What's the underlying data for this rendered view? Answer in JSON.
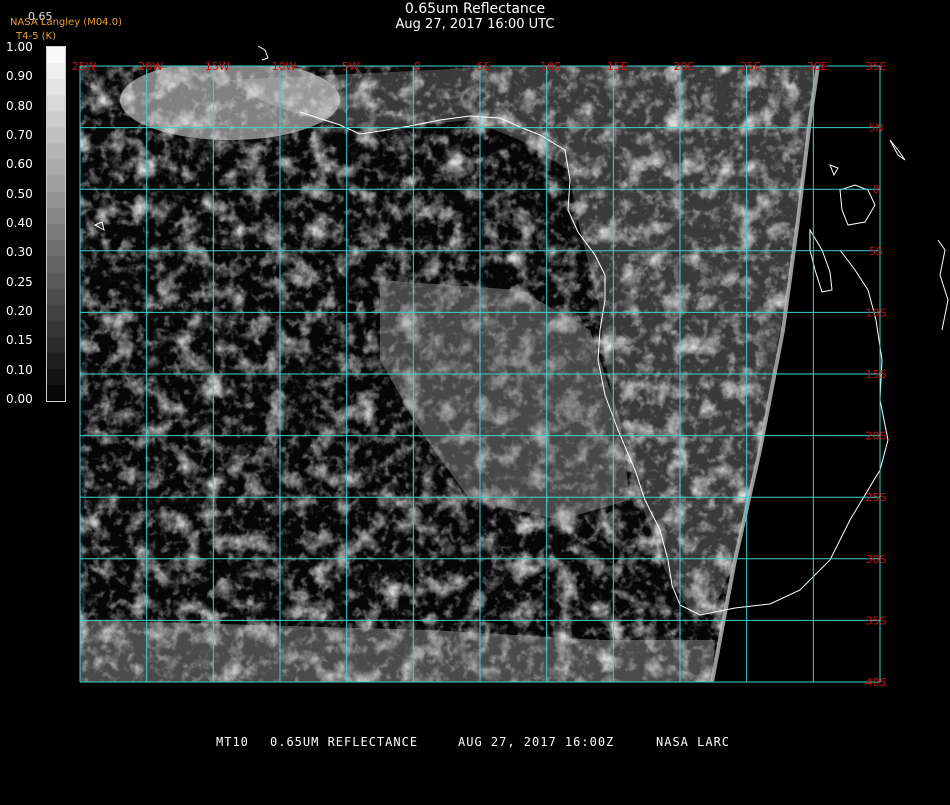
{
  "header": {
    "title": "0.65um Reflectance",
    "subtitle": "Aug 27, 2017 16:00 UTC",
    "source": "NASA Langley (M04.0)",
    "channel": "T4-5 (K)",
    "top_value": "0.65"
  },
  "colorbar": {
    "ticks": [
      "1.00",
      "0.90",
      "0.80",
      "0.70",
      "0.60",
      "0.50",
      "0.40",
      "0.30",
      "0.25",
      "0.20",
      "0.15",
      "0.10",
      "0.00"
    ]
  },
  "map": {
    "longitude_labels": [
      "25W",
      "20W",
      "15W",
      "10W",
      "5W",
      "0",
      "5E",
      "10E",
      "15E",
      "20E",
      "25E",
      "30E",
      "35E"
    ],
    "latitude_labels": [
      "5N",
      "0",
      "5S",
      "10S",
      "15S",
      "20S",
      "25S",
      "30S",
      "35S",
      "40S"
    ],
    "colors": {
      "grid": "#40d0d0",
      "labels": "#cc1111",
      "coastline": "#ffffff",
      "background": "#000000"
    }
  },
  "footer": {
    "satellite": "MT10",
    "product": "0.65UM REFLECTANCE",
    "datetime": "AUG 27, 2017 16:00Z",
    "agency": "NASA LARC"
  }
}
